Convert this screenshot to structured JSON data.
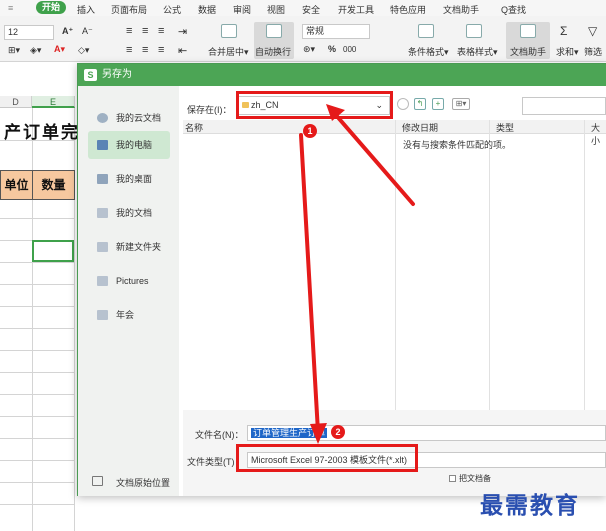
{
  "ribbon": {
    "tabs": [
      "开始",
      "插入",
      "页面布局",
      "公式",
      "数据",
      "审阅",
      "视图",
      "安全",
      "开发工具",
      "特色应用",
      "文档助手"
    ],
    "search": "Q查找",
    "font_size": "12",
    "number_format": "常规",
    "merge_label": "合并居中",
    "wrap_label": "自动换行",
    "cond_format_label": "条件格式",
    "table_style_label": "表格样式",
    "doc_helper_label": "文档助手",
    "sum_label": "求和",
    "filter_label": "筛选",
    "percent": "%",
    "thousands": "000"
  },
  "sheet": {
    "columns": [
      "D",
      "E"
    ],
    "title": "产订单完",
    "header_cells": [
      "单位",
      "数量"
    ]
  },
  "dialog": {
    "title": "另存为",
    "sidebar": [
      "我的云文档",
      "我的电脑",
      "我的桌面",
      "我的文档",
      "新建文件夹",
      "Pictures",
      "年会"
    ],
    "sidebar_bottom": "文档原始位置",
    "save_in_label": "保存在(I)：",
    "path": "zh_CN",
    "columns": [
      "名称",
      "修改日期",
      "类型",
      "大小"
    ],
    "empty_message": "没有与搜索条件匹配的项。",
    "filename_label": "文件名(N)：",
    "filename_value": "订单管理生产订单",
    "filetype_label": "文件类型(T)：",
    "filetype_value": "Microsoft Excel 97-2003 模板文件(*.xlt)",
    "backup_checkbox_label": "把文档备"
  },
  "annotations": {
    "step1": "1",
    "step2": "2"
  },
  "watermark": "最需教育",
  "colors": {
    "accent_green": "#4ca555",
    "annotation_red": "#e51a1a",
    "header_orange": "#f6c89f",
    "watermark_blue": "#2a4fb0"
  }
}
